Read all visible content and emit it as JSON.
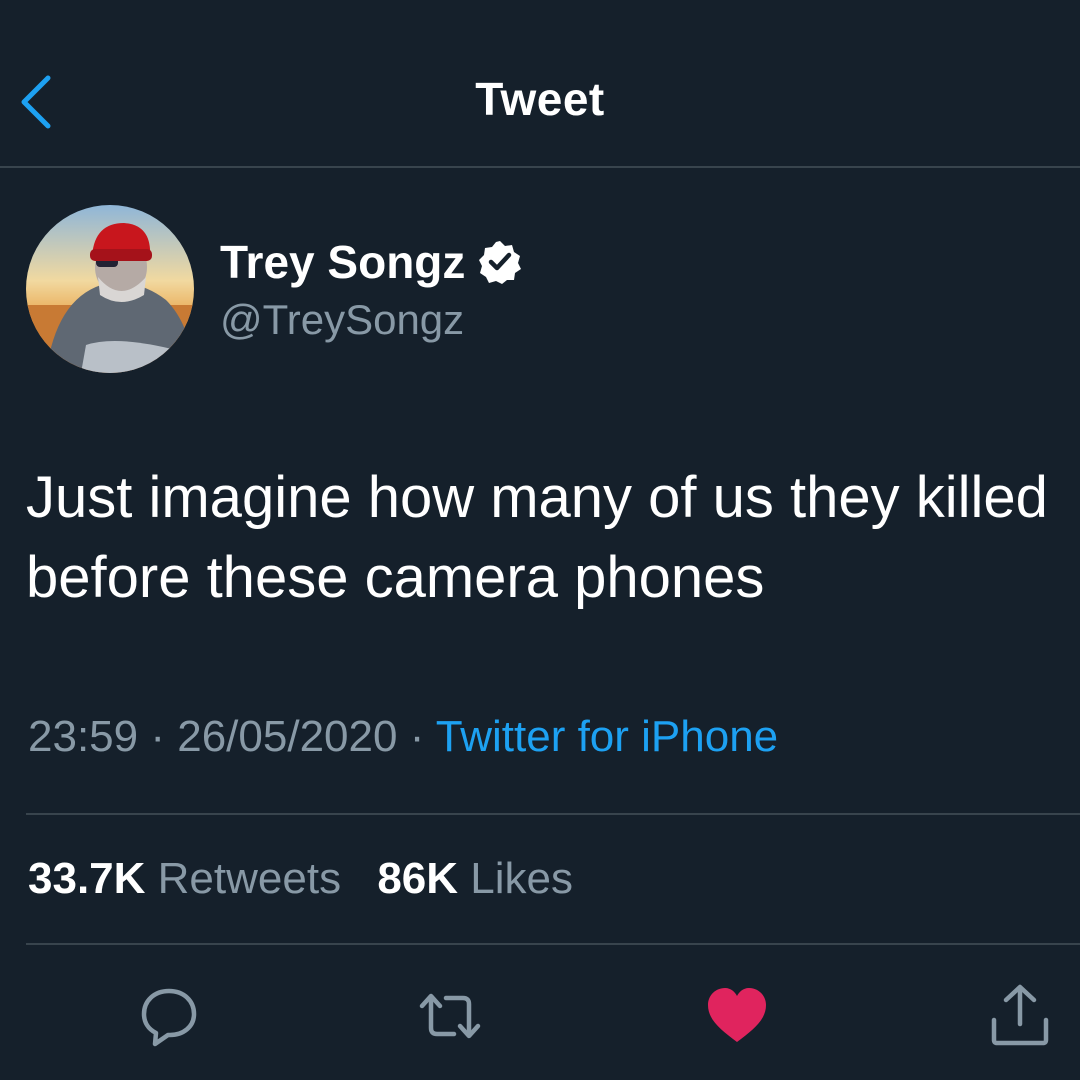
{
  "header": {
    "title": "Tweet",
    "back_icon": "chevron-left-icon"
  },
  "author": {
    "display_name": "Trey Songz",
    "handle": "@TreySongz",
    "verified_icon": "verified-badge-icon"
  },
  "tweet": {
    "text": "Just imagine how many of us they killed before these camera phones",
    "time": "23:59",
    "date": "26/05/2020",
    "separator": "·",
    "source": "Twitter for iPhone"
  },
  "stats": {
    "retweets_count": "33.7K",
    "retweets_label": "Retweets",
    "likes_count": "86K",
    "likes_label": "Likes"
  },
  "actions": {
    "reply_icon": "reply-icon",
    "retweet_icon": "retweet-icon",
    "like_icon": "heart-icon",
    "share_icon": "share-icon",
    "liked": true
  },
  "colors": {
    "background": "#15202b",
    "accent": "#1da1f2",
    "secondary_text": "#8899a6",
    "divider": "#38444d",
    "like": "#e0245e"
  }
}
